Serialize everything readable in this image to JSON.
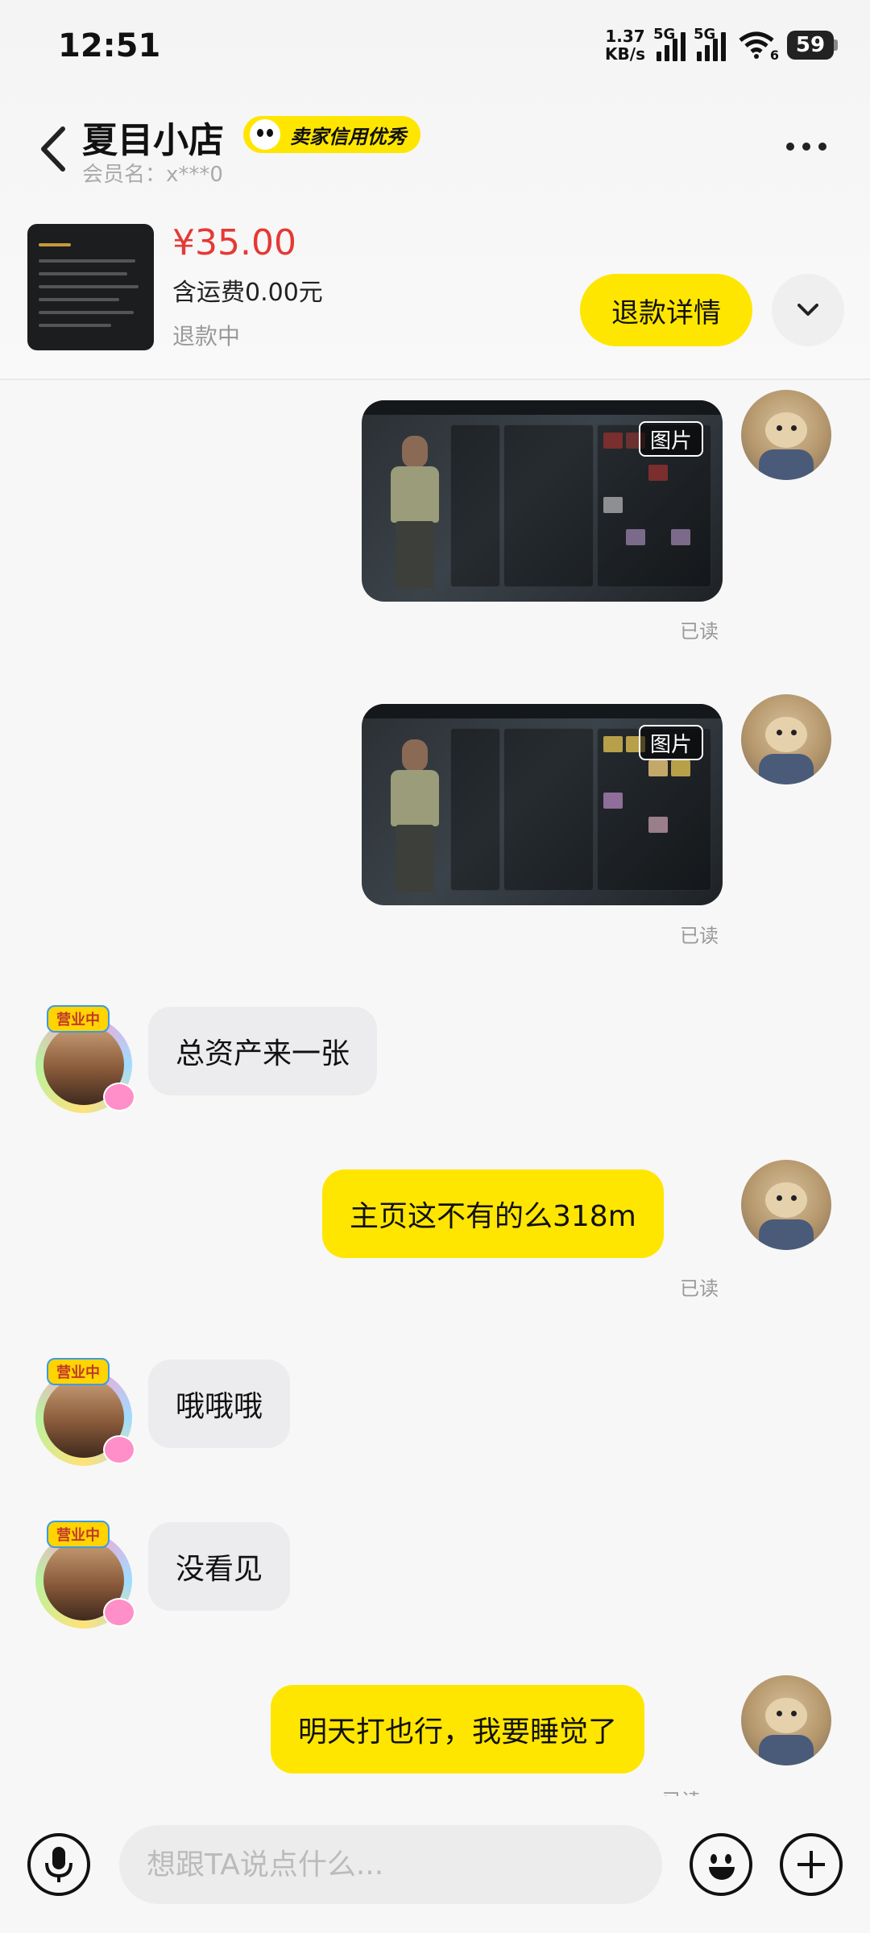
{
  "status_bar": {
    "time": "12:51",
    "net_speed_value": "1.37",
    "net_speed_unit": "KB/s",
    "net1_label": "5G",
    "net2_label": "5G",
    "wifi_label": "6",
    "battery": "59"
  },
  "header": {
    "shop_name": "夏目小店",
    "credit_badge": "卖家信用优秀",
    "member_label": "会员名：x***0"
  },
  "product": {
    "price": "¥35.00",
    "shipping": "含运费0.00元",
    "status": "退款中",
    "refund_button": "退款详情"
  },
  "messages": [
    {
      "sender": "me",
      "type": "image",
      "tag": "图片",
      "read": "已读"
    },
    {
      "sender": "me",
      "type": "image",
      "tag": "图片",
      "read": "已读"
    },
    {
      "sender": "shop",
      "type": "text",
      "text": "总资产来一张"
    },
    {
      "sender": "me",
      "type": "text",
      "text": "主页这不有的么318m",
      "read": "已读"
    },
    {
      "sender": "shop",
      "type": "text",
      "text": "哦哦哦"
    },
    {
      "sender": "shop",
      "type": "text",
      "text": "没看见"
    },
    {
      "sender": "me",
      "type": "text",
      "text": "明天打也行，我要睡觉了",
      "read": "已读"
    }
  ],
  "shop_avatar_badge": "营业中",
  "input": {
    "placeholder": "想跟TA说点什么..."
  },
  "icons": {
    "back": "chevron-left-icon",
    "more": "more-dots-icon",
    "expand": "chevron-down-icon",
    "mic": "microphone-icon",
    "emoji": "emoji-icon",
    "plus": "plus-icon"
  },
  "colors": {
    "accent": "#ffe600",
    "price": "#e53935",
    "bubble_in": "#ececee",
    "muted": "#999999"
  }
}
